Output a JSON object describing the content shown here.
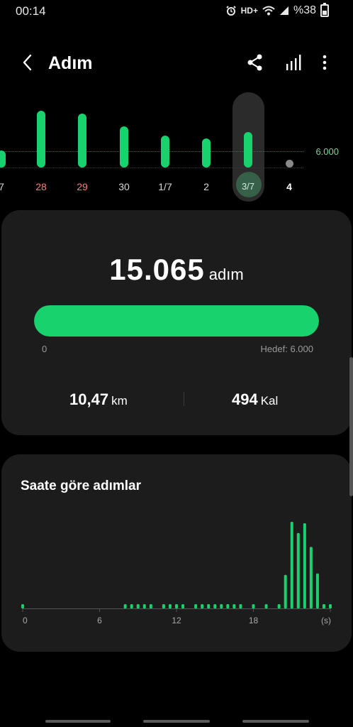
{
  "status": {
    "time": "00:14",
    "network": "HD+",
    "battery": "%38",
    "icons": [
      "alarm-icon",
      "wifi-icon",
      "signal-icon",
      "battery-icon"
    ]
  },
  "header": {
    "title": "Adım",
    "icons": [
      "back-arrow-icon",
      "share-icon",
      "bar-chart-icon",
      "more-vert-icon"
    ]
  },
  "daily_chart": {
    "goal_label": "6.000",
    "days": [
      {
        "label": "7",
        "steps": 1300,
        "weekend": false
      },
      {
        "label": "28",
        "steps": 4300,
        "weekend": true
      },
      {
        "label": "29",
        "steps": 4100,
        "weekend": true
      },
      {
        "label": "30",
        "steps": 3100,
        "weekend": false
      },
      {
        "label": "1/7",
        "steps": 2400,
        "weekend": false
      },
      {
        "label": "2",
        "steps": 2200,
        "weekend": false
      },
      {
        "label": "3/7",
        "steps": 2700,
        "weekend": false,
        "selected": true
      },
      {
        "label": "4",
        "steps": 0,
        "weekend": false,
        "today": true
      }
    ]
  },
  "summary": {
    "steps": "15.065",
    "steps_unit": "adım",
    "progress_fraction": 1.0,
    "progress_min": "0",
    "progress_goal": "Hedef: 6.000",
    "distance_value": "10,47",
    "distance_unit": "km",
    "calories_value": "494",
    "calories_unit": "Kal"
  },
  "hourly": {
    "title": "Saate göre adımlar",
    "x_ticks": [
      "0",
      "6",
      "12",
      "18",
      "(s)"
    ],
    "colors": {
      "bar": "#18d26e",
      "axis": "#555555"
    }
  },
  "chart_data": {
    "type": "bar",
    "title": "Saate göre adımlar",
    "xlabel": "(s)",
    "ylabel": "",
    "xlim": [
      0,
      24
    ],
    "x": [
      0,
      8,
      8.5,
      9,
      9.5,
      10,
      11,
      11.5,
      12,
      12.5,
      13.5,
      14,
      14.5,
      15,
      15.5,
      16,
      16.5,
      17,
      18,
      19,
      20,
      20.5,
      21,
      21.5,
      22,
      22.5,
      23,
      23.5,
      24
    ],
    "values": [
      40,
      30,
      30,
      30,
      30,
      30,
      30,
      30,
      30,
      30,
      30,
      30,
      30,
      30,
      30,
      60,
      30,
      30,
      30,
      30,
      30,
      2400,
      6200,
      5400,
      6100,
      4400,
      2500,
      110,
      40
    ]
  },
  "colors": {
    "accent": "#18d26e",
    "weekend": "#ff7a7a",
    "card": "#1c1c1c",
    "background": "#000000"
  }
}
